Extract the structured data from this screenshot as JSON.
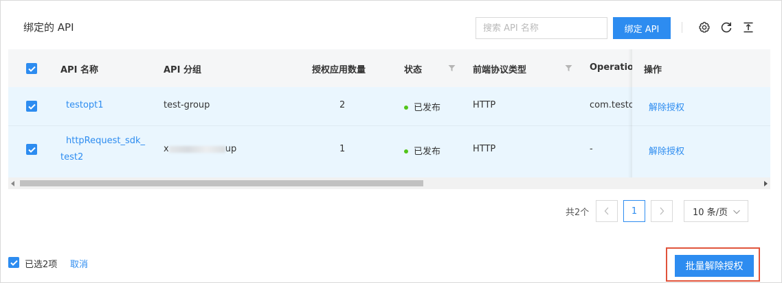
{
  "header": {
    "title": "绑定的 API",
    "search_placeholder": "搜索 API 名称",
    "bind_button": "绑定 API"
  },
  "table": {
    "columns": [
      "API 名称",
      "API 分组",
      "授权应用数量",
      "状态",
      "前端协议类型",
      "Operation",
      "操作"
    ],
    "rows": [
      {
        "selected": true,
        "api_name": "testopt1",
        "api_name_line2": "",
        "group": "test-group",
        "app_count": "2",
        "status": "已发布",
        "protocol": "HTTP",
        "operation": "com.testop",
        "action": "解除授权"
      },
      {
        "selected": true,
        "api_name": "httpRequest_sdk_",
        "api_name_line2": "test2",
        "group_prefix": "x",
        "group_suffix": "up",
        "app_count": "1",
        "status": "已发布",
        "protocol": "HTTP",
        "operation": "-",
        "action": "解除授权"
      }
    ]
  },
  "pagination": {
    "total": "共2个",
    "current_page": "1",
    "page_size": "10 条/页"
  },
  "footer": {
    "selected_text": "已选2项",
    "cancel": "取消",
    "bulk_button": "批量解除授权"
  },
  "colors": {
    "primary": "#2d8cf0",
    "row_selected": "#eaf6fe",
    "status_published": "#52c41a",
    "highlight_border": "#e0533a"
  },
  "icons": [
    "search-icon",
    "settings-icon",
    "refresh-icon",
    "column-height-icon",
    "filter-icon",
    "check-icon",
    "chevron-left-icon",
    "chevron-right-icon",
    "chevron-down-icon"
  ]
}
